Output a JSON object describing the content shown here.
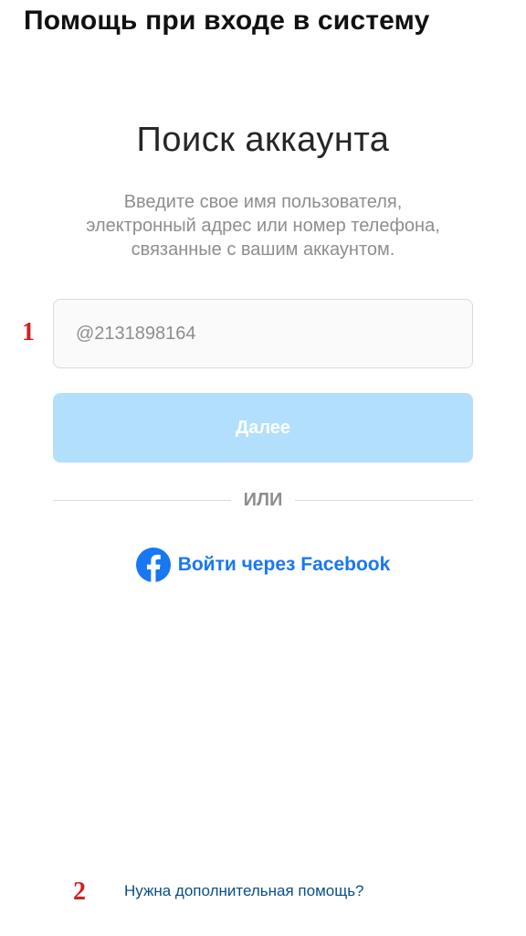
{
  "header": {
    "title": "Помощь при входе в систему"
  },
  "main": {
    "title": "Поиск аккаунта",
    "subtitle_lines": [
      "Введите свое имя пользователя,",
      "электронный адрес или номер телефона,",
      "связанные с вашим аккаунтом."
    ],
    "input": {
      "value": "",
      "placeholder": "@2131898164"
    },
    "next_button_label": "Далее",
    "divider_label": "ИЛИ",
    "facebook_login": {
      "label": "Войти через Facebook",
      "icon": "facebook-icon"
    },
    "help_link": "Нужна дополнительная помощь?"
  },
  "annotations": {
    "one": "1",
    "two": "2"
  },
  "colors": {
    "accent_blue": "#1877f2",
    "button_disabled": "#b2dffc",
    "marker_red": "#d21f1f",
    "link_blue": "#0a4e8a"
  }
}
